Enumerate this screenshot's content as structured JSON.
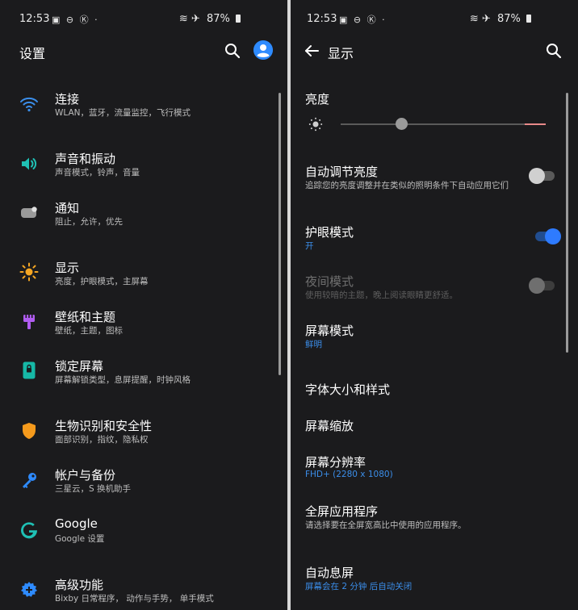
{
  "status": {
    "time": "12:53",
    "battery": "87%"
  },
  "left": {
    "title": "设置",
    "items": [
      {
        "title": "连接",
        "sub": "WLAN，蓝牙，流量监控，飞行模式"
      },
      {
        "title": "声音和振动",
        "sub": "声音模式，铃声，音量"
      },
      {
        "title": "通知",
        "sub": "阻止，允许，优先"
      },
      {
        "title": "显示",
        "sub": "亮度，护眼模式，主屏幕"
      },
      {
        "title": "壁纸和主题",
        "sub": "壁纸，主题，图标"
      },
      {
        "title": "锁定屏幕",
        "sub": "屏幕解锁类型，息屏提醒，时钟风格"
      },
      {
        "title": "生物识别和安全性",
        "sub": "面部识别，指纹，隐私权"
      },
      {
        "title": "帐户与备份",
        "sub": "三星云，S 换机助手"
      },
      {
        "title": "Google",
        "sub": "Google 设置"
      },
      {
        "title": "高级功能",
        "sub": "Bixby 日常程序， 动作与手势， 单手模式"
      }
    ]
  },
  "right": {
    "title": "显示",
    "brightness": {
      "label": "亮度",
      "level": 0.2
    },
    "auto_brightness": {
      "title": "自动调节亮度",
      "sub": "追踪您的亮度调整并在类似的照明条件下自动应用它们",
      "on": false
    },
    "eye_comfort": {
      "title": "护眼模式",
      "sub": "开",
      "on": true
    },
    "night_mode": {
      "title": "夜间模式",
      "sub": "使用较暗的主题，晚上阅读眼睛更舒适。",
      "on": false
    },
    "screen_mode": {
      "title": "屏幕模式",
      "sub": "鲜明"
    },
    "font": {
      "title": "字体大小和样式"
    },
    "zoom": {
      "title": "屏幕缩放"
    },
    "resolution": {
      "title": "屏幕分辨率",
      "sub": "FHD+ (2280 x 1080)"
    },
    "fullscreen": {
      "title": "全屏应用程序",
      "sub": "请选择要在全屏宽高比中使用的应用程序。"
    },
    "timeout": {
      "title": "自动息屏",
      "sub": "屏幕会在 2 分钟 后自动关闭"
    }
  },
  "colors": {
    "accent": "#3b8eea",
    "toggle_on": "#2e7bff",
    "background": "#1b1b1d"
  }
}
